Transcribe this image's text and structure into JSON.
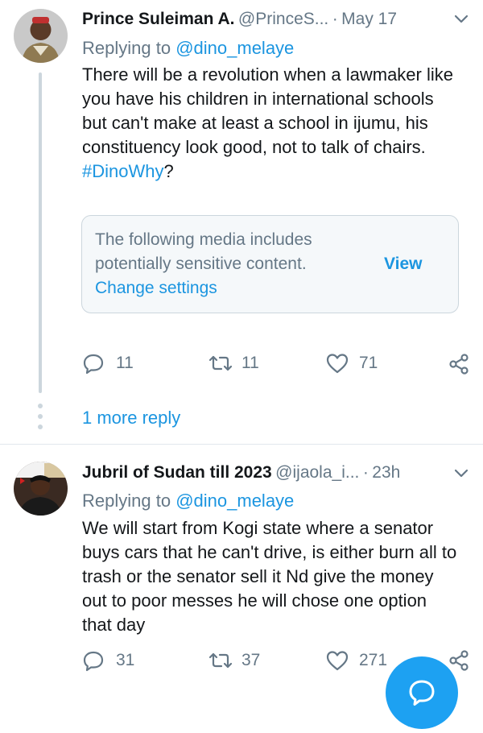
{
  "tweets": [
    {
      "author_name": "Prince Suleiman A.",
      "author_handle": "@PrinceS...",
      "separator": "·",
      "date": "May 17",
      "replying_prefix": "Replying to",
      "replying_to": "@dino_melaye",
      "text_parts": [
        "There will be a revolution when a lawmaker like you have his children in international schools but can't make at least a school in ijumu, his constituency look good, not to talk of chairs. ",
        "#DinoWhy",
        "?"
      ],
      "sensitive_notice": {
        "text": "The following media includes potentially sensitive content.",
        "view_label": "View",
        "settings_label": "Change settings"
      },
      "actions": {
        "replies": "11",
        "retweets": "11",
        "likes": "71"
      },
      "more_replies": "1 more reply"
    },
    {
      "author_name": "Jubril of Sudan till 2023",
      "author_handle": "@ijaola_i...",
      "separator": "·",
      "date": "23h",
      "replying_prefix": "Replying to",
      "replying_to": "@dino_melaye",
      "text": "We will start from Kogi state where a senator buys cars that he can't drive,  is either burn all to trash or the senator sell it Nd give the money out to poor messes he will chose one option that day",
      "actions": {
        "replies": "31",
        "retweets": "37",
        "likes": "271"
      }
    }
  ],
  "icons": {
    "reply": "reply-bubble-icon",
    "retweet": "retweet-icon",
    "like": "heart-icon",
    "share": "share-icon",
    "more": "chevron-down-icon",
    "compose": "compose-reply-icon"
  },
  "colors": {
    "accent": "#1b95e0",
    "muted": "#657786",
    "fab": "#1da1f2",
    "border": "#ccd6dd"
  }
}
